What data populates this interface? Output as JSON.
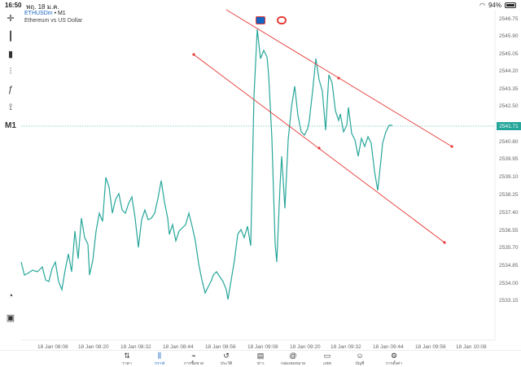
{
  "status": {
    "time": "16:50",
    "date": "พฤ. 18 ม.ค.",
    "battery": "94%"
  },
  "toolbar": {
    "timeframe": "M1",
    "icons": [
      "crosshair-icon",
      "candlestick-icon",
      "bar-chart-icon",
      "indicators-icon",
      "function-icon",
      "objects-icon"
    ]
  },
  "symbol": {
    "title_symbol": "ETHUSDm",
    "title_sep": " • M1",
    "description": "Ethereum vs US Dollar"
  },
  "price_axis": [
    "2546.75",
    "2545.90",
    "2545.05",
    "2544.20",
    "2543.35",
    "2542.50",
    "2541.71",
    "2540.80",
    "2539.95",
    "2539.10",
    "2538.25",
    "2537.40",
    "2536.55",
    "2535.70",
    "2534.85",
    "2534.00",
    "2533.15"
  ],
  "current_price": "2541.71",
  "time_axis": [
    "18 Jan 08:08",
    "18 Jan 08:20",
    "18 Jan 08:32",
    "18 Jan 08:44",
    "18 Jan 08:56",
    "18 Jan 09:08",
    "18 Jan 09:20",
    "18 Jan 09:32",
    "18 Jan 09:44",
    "18 Jan 09:56",
    "18 Jan 10:08"
  ],
  "nav": [
    {
      "label": "ราคา",
      "icon": "quotes-icon",
      "glyph": "⇅"
    },
    {
      "label": "กราฟ",
      "icon": "chart-icon",
      "glyph": "⫼"
    },
    {
      "label": "การซื้อขาย",
      "icon": "trade-icon",
      "glyph": "⌁"
    },
    {
      "label": "ประวัติ",
      "icon": "history-icon",
      "glyph": "↺"
    },
    {
      "label": "ข่าว",
      "icon": "news-icon",
      "glyph": "▤"
    },
    {
      "label": "กล่องจดหมาย",
      "icon": "mailbox-icon",
      "glyph": "@"
    },
    {
      "label": "แชท",
      "icon": "chat-icon",
      "glyph": "▭"
    },
    {
      "label": "บัญชี",
      "icon": "account-icon",
      "glyph": "☺"
    },
    {
      "label": "การตั้งค่า",
      "icon": "settings-icon",
      "glyph": "⚙"
    }
  ],
  "colors": {
    "line": "#26a69a",
    "trendline": "#e53935",
    "accent": "#1565c0"
  }
}
